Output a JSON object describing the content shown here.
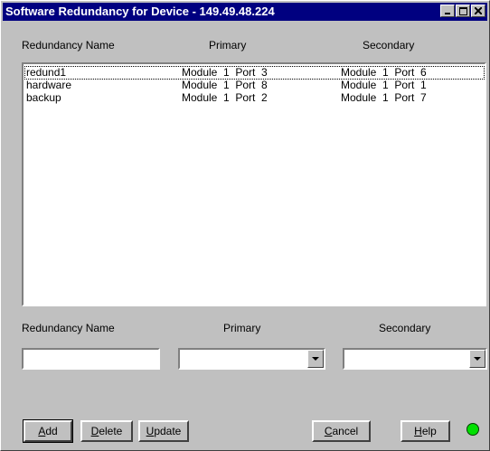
{
  "window": {
    "title": "Software Redundancy for Device - 149.49.48.224"
  },
  "list": {
    "headers": [
      "Redundancy Name",
      "Primary",
      "Secondary"
    ],
    "rows": [
      {
        "name": "redund1",
        "primary": "Module  1  Port  3",
        "secondary": "Module  1  Port  6",
        "selected": true
      },
      {
        "name": "hardware",
        "primary": "Module  1  Port  8",
        "secondary": "Module  1  Port  1",
        "selected": false
      },
      {
        "name": "backup",
        "primary": "Module  1  Port  2",
        "secondary": "Module  1  Port  7",
        "selected": false
      }
    ]
  },
  "form": {
    "name_label": "Redundancy Name",
    "primary_label": "Primary",
    "secondary_label": "Secondary",
    "name_value": "",
    "primary_value": "",
    "secondary_value": ""
  },
  "buttons": {
    "add": {
      "mnemonic": "A",
      "rest": "dd"
    },
    "delete": {
      "mnemonic": "D",
      "rest": "elete"
    },
    "update": {
      "mnemonic": "U",
      "rest": "pdate"
    },
    "cancel": {
      "mnemonic": "C",
      "rest": "ancel"
    },
    "help": {
      "mnemonic": "H",
      "rest": "elp"
    }
  },
  "status": {
    "indicator_color": "#00e000"
  },
  "icons": {
    "minimize": "minimize-icon",
    "maximize": "maximize-icon",
    "close": "close-icon",
    "dropdown": "chevron-down-icon"
  }
}
